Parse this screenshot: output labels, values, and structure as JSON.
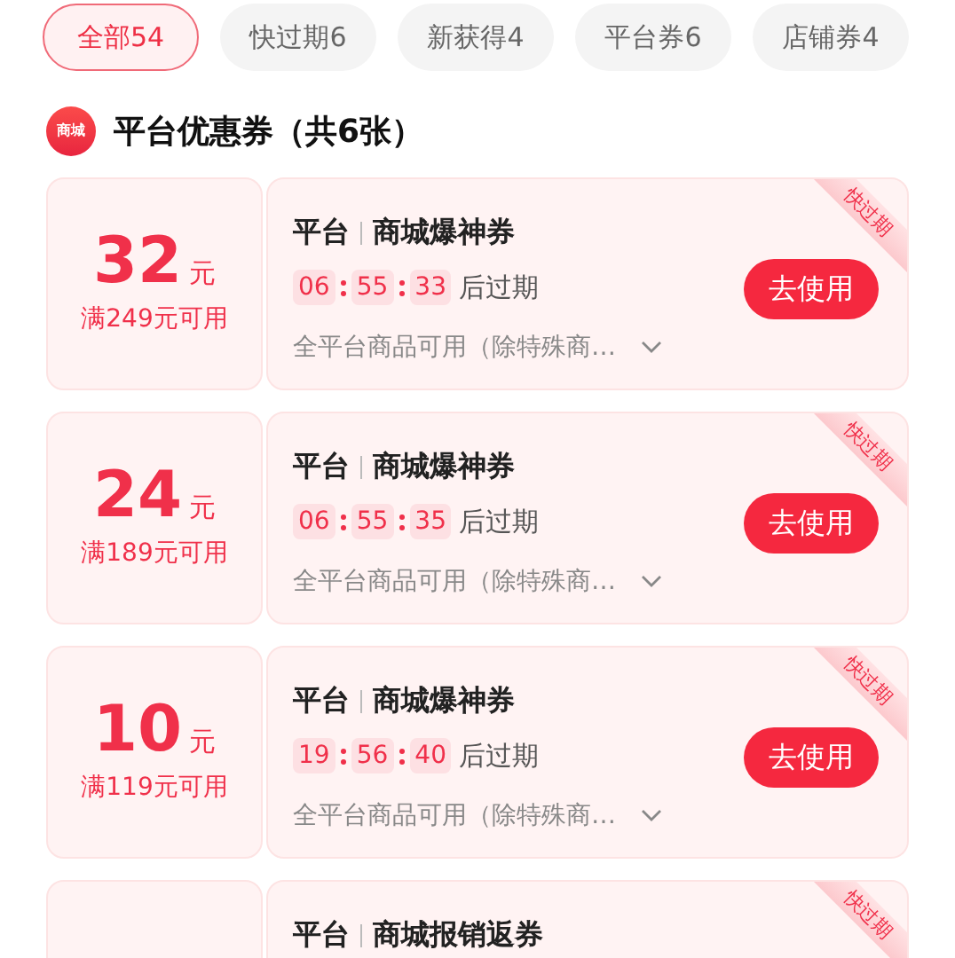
{
  "tabs": [
    {
      "label": "全部54",
      "selected": true
    },
    {
      "label": "快过期6",
      "selected": false
    },
    {
      "label": "新获得4",
      "selected": false
    },
    {
      "label": "平台券6",
      "selected": false
    },
    {
      "label": "店铺券4",
      "selected": false
    }
  ],
  "section": {
    "icon_text": "商城",
    "title": "平台优惠券（共6张）"
  },
  "coupons": [
    {
      "amount": "32",
      "unit": "元",
      "condition": "满249元可用",
      "source": "平台",
      "name": "商城爆神券",
      "timer": [
        "06",
        "55",
        "33"
      ],
      "timer_suffix": "后过期",
      "description": "全平台商品可用（除特殊商…",
      "button": "去使用",
      "ribbon": "快过期"
    },
    {
      "amount": "24",
      "unit": "元",
      "condition": "满189元可用",
      "source": "平台",
      "name": "商城爆神券",
      "timer": [
        "06",
        "55",
        "35"
      ],
      "timer_suffix": "后过期",
      "description": "全平台商品可用（除特殊商…",
      "button": "去使用",
      "ribbon": "快过期"
    },
    {
      "amount": "10",
      "unit": "元",
      "condition": "满119元可用",
      "source": "平台",
      "name": "商城爆神券",
      "timer": [
        "19",
        "56",
        "40"
      ],
      "timer_suffix": "后过期",
      "description": "全平台商品可用（除特殊商…",
      "button": "去使用",
      "ribbon": "快过期"
    },
    {
      "source": "平台",
      "name": "商城报销返券",
      "ribbon": "快过期"
    }
  ]
}
